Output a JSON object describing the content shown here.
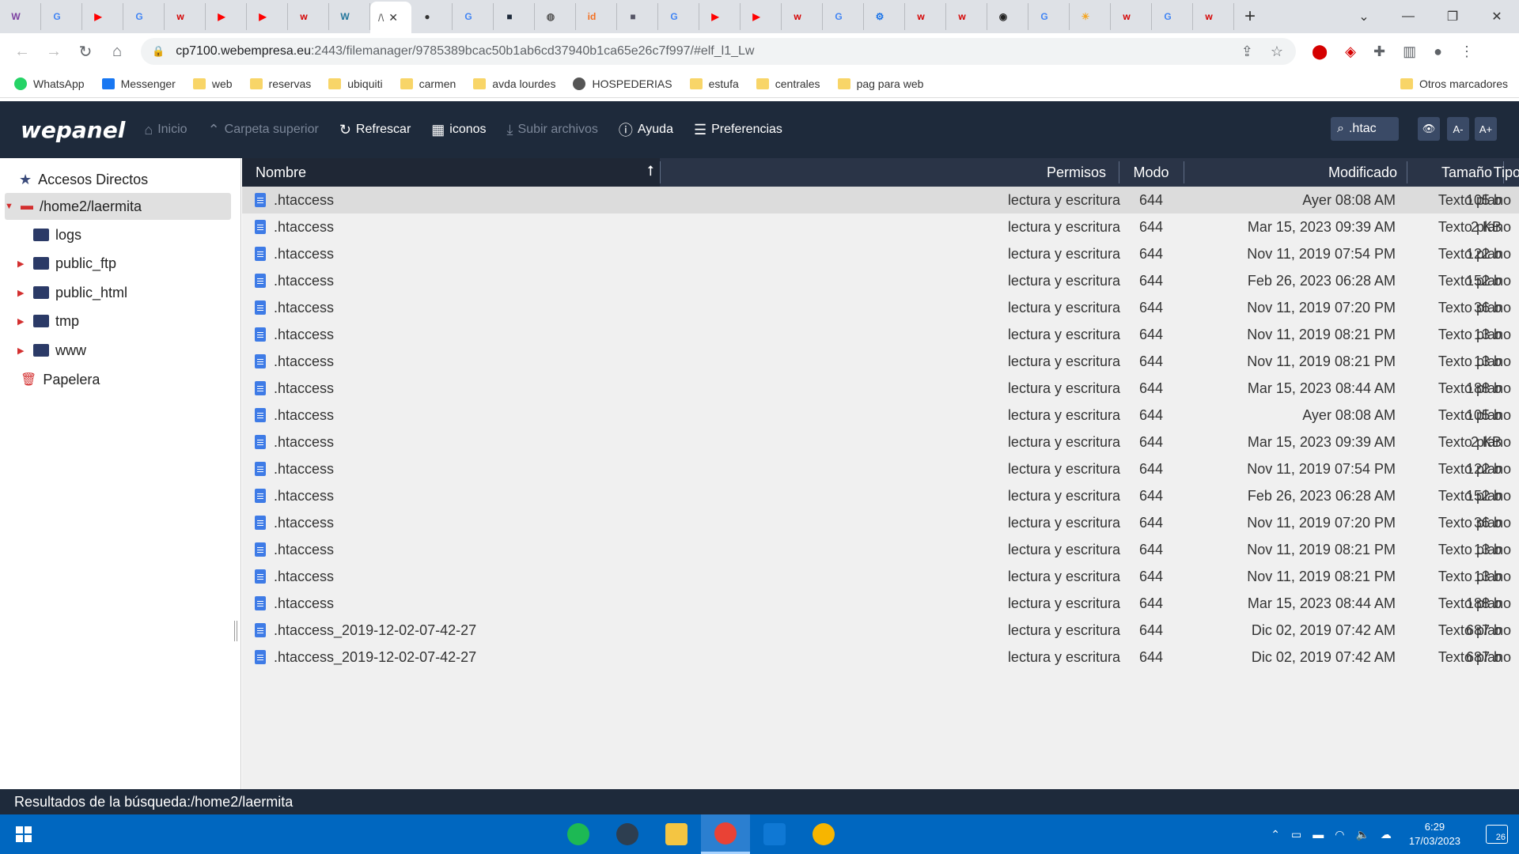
{
  "browser": {
    "tabs": [
      {
        "icon": "wikipedia-icon",
        "glyph": "W",
        "color": "#7b3fa0"
      },
      {
        "icon": "google-icon",
        "glyph": "G",
        "color": "#4285f4"
      },
      {
        "icon": "youtube-icon",
        "glyph": "▶",
        "color": "#ff0000"
      },
      {
        "icon": "google-icon",
        "glyph": "G",
        "color": "#4285f4"
      },
      {
        "icon": "wepanel-icon",
        "glyph": "w",
        "color": "#d50000"
      },
      {
        "icon": "youtube-icon",
        "glyph": "▶",
        "color": "#ff0000"
      },
      {
        "icon": "youtube-icon",
        "glyph": "▶",
        "color": "#ff0000"
      },
      {
        "icon": "wepanel-icon",
        "glyph": "w",
        "color": "#d50000"
      },
      {
        "icon": "wordpress-icon",
        "glyph": "W",
        "color": "#21759b"
      }
    ],
    "active_tab_label": "/\\",
    "tabs_after": [
      {
        "icon": "spy-icon",
        "glyph": "●",
        "color": "#333"
      },
      {
        "icon": "google-icon",
        "glyph": "G",
        "color": "#4285f4"
      },
      {
        "icon": "dark-site-icon",
        "glyph": "■",
        "color": "#1e2a3b"
      },
      {
        "icon": "globe-icon",
        "glyph": "◍",
        "color": "#555"
      },
      {
        "icon": "id-icon",
        "glyph": "id",
        "color": "#f36f21"
      },
      {
        "icon": "photo-icon",
        "glyph": "■",
        "color": "#556"
      },
      {
        "icon": "google-icon",
        "glyph": "G",
        "color": "#4285f4"
      },
      {
        "icon": "youtube-icon",
        "glyph": "▶",
        "color": "#ff0000"
      },
      {
        "icon": "youtube-icon",
        "glyph": "▶",
        "color": "#ff0000"
      },
      {
        "icon": "wepanel-icon",
        "glyph": "w",
        "color": "#d50000"
      },
      {
        "icon": "google-icon",
        "glyph": "G",
        "color": "#4285f4"
      },
      {
        "icon": "gear-icon",
        "glyph": "⚙",
        "color": "#1a73e8"
      },
      {
        "icon": "wepanel-icon",
        "glyph": "w",
        "color": "#d50000"
      },
      {
        "icon": "wepanel-icon",
        "glyph": "w",
        "color": "#d50000"
      },
      {
        "icon": "github-icon",
        "glyph": "◉",
        "color": "#222"
      },
      {
        "icon": "google-icon",
        "glyph": "G",
        "color": "#4285f4"
      },
      {
        "icon": "sun-icon",
        "glyph": "☀",
        "color": "#f5a623"
      },
      {
        "icon": "wepanel-icon",
        "glyph": "w",
        "color": "#d50000"
      },
      {
        "icon": "google-icon",
        "glyph": "G",
        "color": "#4285f4"
      },
      {
        "icon": "wepanel-icon",
        "glyph": "w",
        "color": "#d50000"
      }
    ],
    "url_host": "cp7100.webempresa.eu",
    "url_rest": ":2443/filemanager/9785389bcac50b1ab6cd37940b1ca65e26c7f997/#elf_l1_Lw",
    "bookmarks": [
      {
        "label": "WhatsApp",
        "icon": "whatsapp-icon"
      },
      {
        "label": "Messenger",
        "icon": "messenger-icon"
      },
      {
        "label": "web",
        "icon": "folder-icon"
      },
      {
        "label": "reservas",
        "icon": "folder-icon"
      },
      {
        "label": "ubiquiti",
        "icon": "folder-icon"
      },
      {
        "label": "carmen",
        "icon": "folder-icon"
      },
      {
        "label": "avda lourdes",
        "icon": "folder-icon"
      },
      {
        "label": "HOSPEDERIAS",
        "icon": "globe-icon"
      },
      {
        "label": "estufa",
        "icon": "folder-icon"
      },
      {
        "label": "centrales",
        "icon": "folder-icon"
      },
      {
        "label": "pag para web",
        "icon": "folder-icon"
      }
    ],
    "other_bookmarks": "Otros marcadores"
  },
  "app": {
    "logo": "wepanel",
    "toolbar": {
      "home": "Inicio",
      "up": "Carpeta superior",
      "refresh": "Refrescar",
      "icons": "iconos",
      "upload": "Subir archivos",
      "help": "Ayuda",
      "prefs": "Preferencias"
    },
    "search_value": ".htac",
    "font_smaller": "A-",
    "font_larger": "A+"
  },
  "tree": {
    "shortcuts": "Accesos Directos",
    "root": "/home2/laermita",
    "children": [
      "logs",
      "public_ftp",
      "public_html",
      "tmp",
      "www"
    ],
    "trash": "Papelera"
  },
  "columns": {
    "name": "Nombre",
    "perms": "Permisos",
    "mode": "Modo",
    "modified": "Modificado",
    "size": "Tamaño",
    "type": "Tipo"
  },
  "files": [
    {
      "name": ".htaccess",
      "perms": "lectura y escritura",
      "mode": "644",
      "modified": "Ayer 08:08 AM",
      "size": "105 b",
      "type": "Texto plano"
    },
    {
      "name": ".htaccess",
      "perms": "lectura y escritura",
      "mode": "644",
      "modified": "Mar 15, 2023 09:39 AM",
      "size": "2 KB",
      "type": "Texto plano"
    },
    {
      "name": ".htaccess",
      "perms": "lectura y escritura",
      "mode": "644",
      "modified": "Nov 11, 2019 07:54 PM",
      "size": "122 b",
      "type": "Texto plano"
    },
    {
      "name": ".htaccess",
      "perms": "lectura y escritura",
      "mode": "644",
      "modified": "Feb 26, 2023 06:28 AM",
      "size": "152 b",
      "type": "Texto plano"
    },
    {
      "name": ".htaccess",
      "perms": "lectura y escritura",
      "mode": "644",
      "modified": "Nov 11, 2019 07:20 PM",
      "size": "36 b",
      "type": "Texto plano"
    },
    {
      "name": ".htaccess",
      "perms": "lectura y escritura",
      "mode": "644",
      "modified": "Nov 11, 2019 08:21 PM",
      "size": "13 b",
      "type": "Texto plano"
    },
    {
      "name": ".htaccess",
      "perms": "lectura y escritura",
      "mode": "644",
      "modified": "Nov 11, 2019 08:21 PM",
      "size": "13 b",
      "type": "Texto plano"
    },
    {
      "name": ".htaccess",
      "perms": "lectura y escritura",
      "mode": "644",
      "modified": "Mar 15, 2023 08:44 AM",
      "size": "188 b",
      "type": "Texto plano"
    },
    {
      "name": ".htaccess",
      "perms": "lectura y escritura",
      "mode": "644",
      "modified": "Ayer 08:08 AM",
      "size": "105 b",
      "type": "Texto plano"
    },
    {
      "name": ".htaccess",
      "perms": "lectura y escritura",
      "mode": "644",
      "modified": "Mar 15, 2023 09:39 AM",
      "size": "2 KB",
      "type": "Texto plano"
    },
    {
      "name": ".htaccess",
      "perms": "lectura y escritura",
      "mode": "644",
      "modified": "Nov 11, 2019 07:54 PM",
      "size": "122 b",
      "type": "Texto plano"
    },
    {
      "name": ".htaccess",
      "perms": "lectura y escritura",
      "mode": "644",
      "modified": "Feb 26, 2023 06:28 AM",
      "size": "152 b",
      "type": "Texto plano"
    },
    {
      "name": ".htaccess",
      "perms": "lectura y escritura",
      "mode": "644",
      "modified": "Nov 11, 2019 07:20 PM",
      "size": "36 b",
      "type": "Texto plano"
    },
    {
      "name": ".htaccess",
      "perms": "lectura y escritura",
      "mode": "644",
      "modified": "Nov 11, 2019 08:21 PM",
      "size": "13 b",
      "type": "Texto plano"
    },
    {
      "name": ".htaccess",
      "perms": "lectura y escritura",
      "mode": "644",
      "modified": "Nov 11, 2019 08:21 PM",
      "size": "13 b",
      "type": "Texto plano"
    },
    {
      "name": ".htaccess",
      "perms": "lectura y escritura",
      "mode": "644",
      "modified": "Mar 15, 2023 08:44 AM",
      "size": "188 b",
      "type": "Texto plano"
    },
    {
      "name": ".htaccess_2019-12-02-07-42-27",
      "perms": "lectura y escritura",
      "mode": "644",
      "modified": "Dic 02, 2019 07:42 AM",
      "size": "687 b",
      "type": "Texto plano"
    },
    {
      "name": ".htaccess_2019-12-02-07-42-27",
      "perms": "lectura y escritura",
      "mode": "644",
      "modified": "Dic 02, 2019 07:42 AM",
      "size": "687 b",
      "type": "Texto plano"
    }
  ],
  "status": "Resultados de la búsqueda:/home2/laermita",
  "taskbar": {
    "apps": [
      {
        "icon": "spotify-icon",
        "color": "#1db954"
      },
      {
        "icon": "shark-icon",
        "color": "#2d3e50"
      },
      {
        "icon": "file-explorer-icon",
        "color": "#f4c542"
      },
      {
        "icon": "chrome-icon",
        "color": "#e94235"
      },
      {
        "icon": "outlook-icon",
        "color": "#0f78d4"
      },
      {
        "icon": "weather-icon",
        "color": "#f7b500"
      }
    ],
    "time": "6:29",
    "date": "17/03/2023",
    "notifications": "26"
  }
}
